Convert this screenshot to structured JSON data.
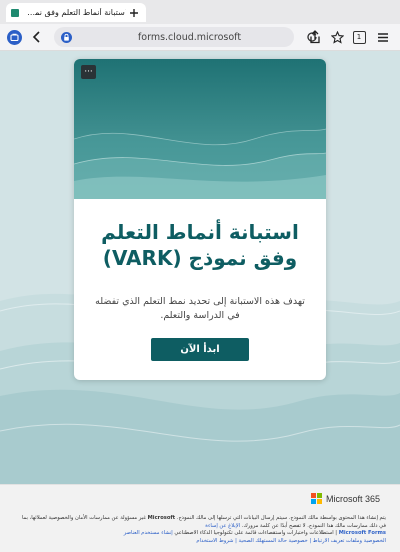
{
  "browser": {
    "tab_title": "استبانة أنماط التعلم وفق نموذج",
    "url": "forms.cloud.microsoft",
    "tab_count": "1"
  },
  "form": {
    "title": "استبانة أنماط التعلم وفق نموذج (VARK)",
    "description": "تهدف هذه الاستبانة إلى تحديد نمط التعلم الذي تفضله في الدراسة والتعلم.",
    "start_button": "ابدأ الآن",
    "more_options": "···"
  },
  "footer": {
    "brand": "Microsoft 365",
    "notice_line1": "يتم إنشاء هذا المحتوى بواسطة مالك النموذج. سيتم إرسال البيانات التي ترسلها إلى مالك النموذج.",
    "notice_ms": "Microsoft",
    "notice_line1b": "غير مسؤولة عن ممارسات الأمان والخصوصية لعملائها، بما في ذلك ممارسات مالك هذا النموذج. لا تفصح أبدًا عن كلمة مرورك.",
    "report_link": "الإبلاغ عن إساءة",
    "notice_line2": "| استطلاعات واختبارات واستقصاءات قائمة على تكنولوجيا الذكاء الاصطناعي",
    "forms_brand": "Microsoft Forms",
    "ai_link": "إنشاء مستخدم العناصر",
    "privacy_links": "الخصوصية وملفات تعريف الارتباط | خصوصية حالة المستهلك الصحية | شروط الاستخدام"
  },
  "colors": {
    "accent": "#0e5d62",
    "header_teal": "#2f8a8a",
    "page_bg": "#d3e4e6"
  },
  "icons": [
    "tab-favicon",
    "close-icon",
    "plus-icon",
    "profile-icon",
    "back-arrow-icon",
    "secure-site-icon",
    "reload-icon",
    "share-icon",
    "bookmark-star-icon",
    "tab-count-icon",
    "menu-icon",
    "more-options-icon",
    "microsoft-logo-icon"
  ]
}
